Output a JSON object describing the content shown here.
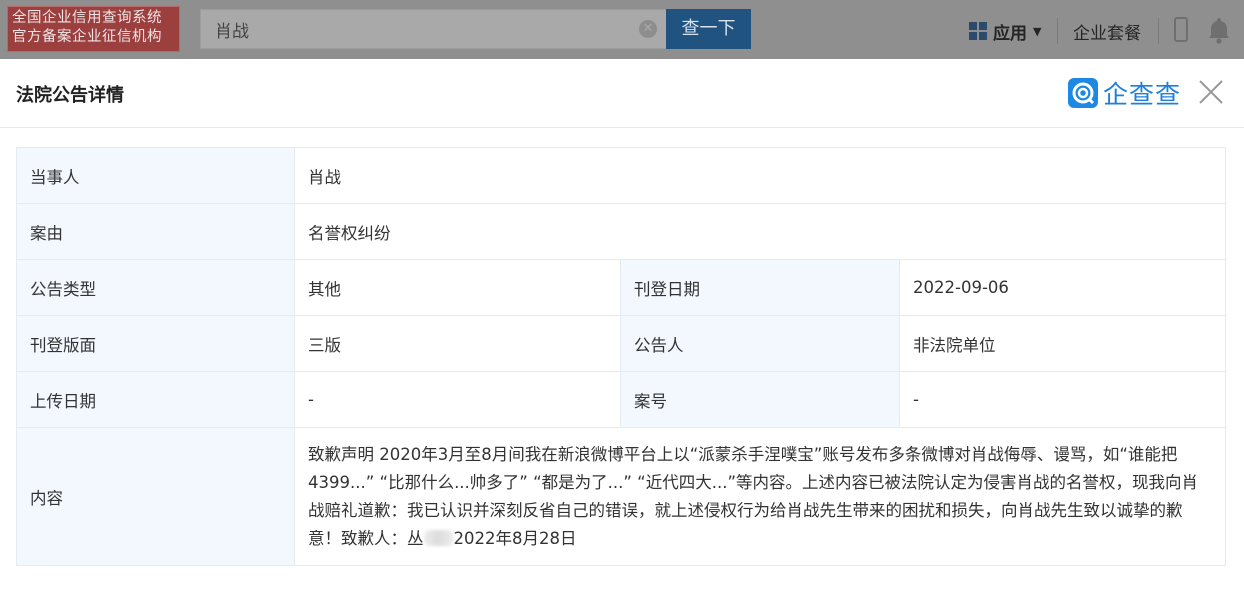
{
  "topbar": {
    "brand_line1": "全国企业信用查询系统",
    "brand_line2": "官方备案企业征信机构",
    "search_value": "肖战",
    "search_button": "查一下",
    "apps_label": "应用",
    "package_label": "企业套餐",
    "icons": [
      "clear-icon",
      "apps-grid-icon",
      "chevron-down-icon",
      "phone-icon",
      "bell-icon"
    ]
  },
  "modal": {
    "title": "法院公告详情",
    "logo_text": "企查查",
    "logo_color": "#1e88e5"
  },
  "details": {
    "party_label": "当事人",
    "party_value": "肖战",
    "cause_label": "案由",
    "cause_value": "名誉权纠纷",
    "type_label": "公告类型",
    "type_value": "其他",
    "pub_date_label": "刊登日期",
    "pub_date_value": "2022-09-06",
    "page_label": "刊登版面",
    "page_value": "三版",
    "announcer_label": "公告人",
    "announcer_value": "非法院单位",
    "upload_label": "上传日期",
    "upload_value": "-",
    "case_no_label": "案号",
    "case_no_value": "-",
    "content_label": "内容",
    "content_part1": "致歉声明 2020年3月至8月间我在新浪微博平台上以“派蒙杀手涅噗宝”账号发布多条微博对肖战侮辱、谩骂，如“谁能把4399...” “比那什么...帅多了” “都是为了...” “近代四大...”等内容。上述内容已被法院认定为侵害肖战的名誉权，现我向肖战赔礼道歉：我已认识并深刻反省自己的错误，就上述侵权行为给肖战先生带来的困扰和损失，向肖战先生致以诚挚的歉意！致歉人：丛",
    "content_part2": "2022年8月28日"
  }
}
